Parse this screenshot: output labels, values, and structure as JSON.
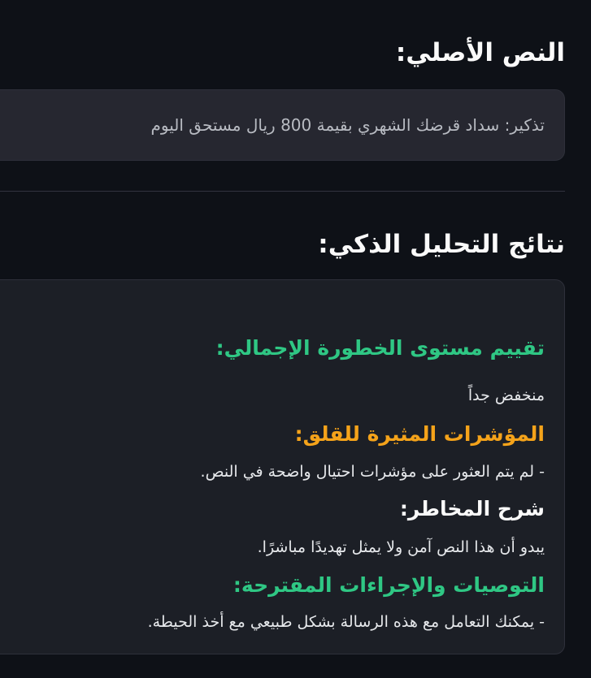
{
  "original": {
    "heading": "النص الأصلي:",
    "text": "تذكير: سداد قرضك الشهري بقيمة 800 ريال مستحق اليوم"
  },
  "results": {
    "heading": "نتائج التحليل الذكي:",
    "risk_heading": "تقييم مستوى الخطورة الإجمالي:",
    "risk_value": "منخفض جداً",
    "indicators_heading": "المؤشرات المثيرة للقلق:",
    "indicators_line": "- لم يتم العثور على مؤشرات احتيال واضحة في النص.",
    "explanation_heading": "شرح المخاطر:",
    "explanation_line": "يبدو أن هذا النص آمن ولا يمثل تهديدًا مباشرًا.",
    "recommendations_heading": "التوصيات والإجراءات المقترحة:",
    "recommendations_line": "- يمكنك التعامل مع هذه الرسالة بشكل طبيعي مع أخذ الحيطة."
  },
  "colors": {
    "background": "#0e1117",
    "box_original": "#262730",
    "box_results": "#1c1f26",
    "accent_green": "#2fc784",
    "accent_orange": "#f5a31a",
    "text_primary": "#fafafa",
    "text_muted": "#b8bbc2"
  }
}
